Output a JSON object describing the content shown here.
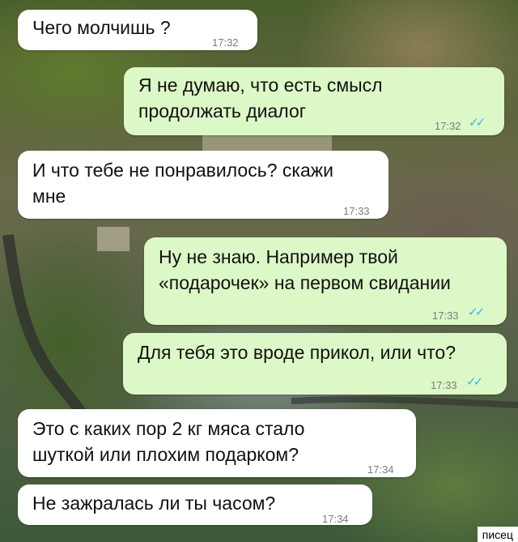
{
  "messages": [
    {
      "dir": "in",
      "text": "Чего молчишь ?",
      "time": "17:32"
    },
    {
      "dir": "out",
      "lines": [
        "Я не думаю, что есть смысл",
        "продолжать диалог"
      ],
      "time": "17:32",
      "read": true
    },
    {
      "dir": "in",
      "lines": [
        "И что тебе не понравилось? скажи",
        "мне"
      ],
      "time": "17:33"
    },
    {
      "dir": "out",
      "lines": [
        "Ну не знаю. Например твой",
        "«подарочек» на первом свидании"
      ],
      "time": "17:33",
      "read": true
    },
    {
      "dir": "out",
      "text": "Для тебя это вроде прикол, или что?",
      "time": "17:33",
      "read": true
    },
    {
      "dir": "in",
      "lines": [
        "Это с каких пор 2 кг мяса стало",
        "шуткой или плохим подарком?"
      ],
      "time": "17:34"
    },
    {
      "dir": "in",
      "text": "Не зажралась ли ты часом?",
      "time": "17:34"
    }
  ],
  "read_icon": "double-check-icon",
  "watermark": "писец",
  "colors": {
    "incoming": "#ffffff",
    "outgoing": "#dcf8c6",
    "read_ticks": "#34b7f1"
  }
}
